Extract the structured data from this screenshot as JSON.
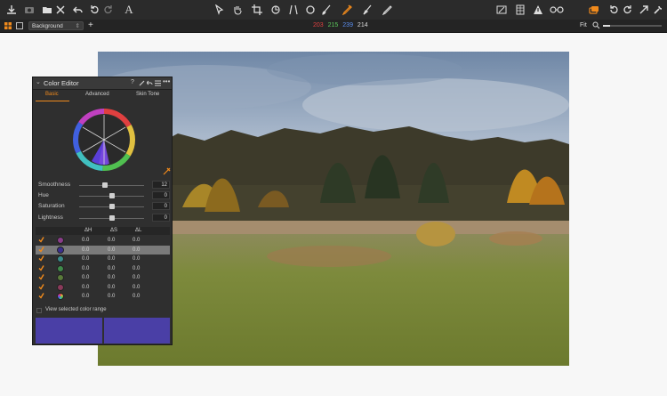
{
  "subbar": {
    "background_label": "Background",
    "readout": {
      "r": "203",
      "g": "215",
      "b": "239",
      "l": "214"
    },
    "fit_label": "Fit"
  },
  "colors": {
    "accent": "#f08a1c",
    "swatch": "#4a3fa6",
    "r": "#e04040",
    "g": "#5cc85c",
    "b": "#5a8ef0"
  },
  "color_editor": {
    "title": "Color Editor",
    "header_icons": [
      "help-icon",
      "picker-icon",
      "undo-icon",
      "list-icon",
      "more-icon"
    ],
    "tabs": [
      {
        "label": "Basic",
        "active": true
      },
      {
        "label": "Advanced",
        "active": false
      },
      {
        "label": "Skin Tone",
        "active": false
      }
    ],
    "sliders": [
      {
        "label": "Smoothness",
        "value": "12",
        "level": 0.4
      },
      {
        "label": "Hue",
        "value": "0",
        "level": 0.5
      },
      {
        "label": "Saturation",
        "value": "0",
        "level": 0.5
      },
      {
        "label": "Lightness",
        "value": "0",
        "level": 0.5
      }
    ],
    "table": {
      "headers": [
        "ΔH",
        "ΔS",
        "ΔL"
      ],
      "rows": [
        {
          "color": "#8a3d8a",
          "dh": "0.0",
          "ds": "0.0",
          "dl": "0.0",
          "selected": false
        },
        {
          "color": "#3b2f8f",
          "dh": "0.0",
          "ds": "0.0",
          "dl": "0.0",
          "selected": true
        },
        {
          "color": "#3a8a8a",
          "dh": "0.0",
          "ds": "0.0",
          "dl": "0.0",
          "selected": false
        },
        {
          "color": "#3f8a4a",
          "dh": "0.0",
          "ds": "0.0",
          "dl": "0.0",
          "selected": false
        },
        {
          "color": "#5a7a3a",
          "dh": "0.0",
          "ds": "0.0",
          "dl": "0.0",
          "selected": false
        },
        {
          "color": "#8a3a5a",
          "dh": "0.0",
          "ds": "0.0",
          "dl": "0.0",
          "selected": false
        },
        {
          "color": "multicolor",
          "dh": "0.0",
          "ds": "0.0",
          "dl": "0.0",
          "selected": false
        }
      ]
    },
    "view_range_label": "View selected color range"
  }
}
